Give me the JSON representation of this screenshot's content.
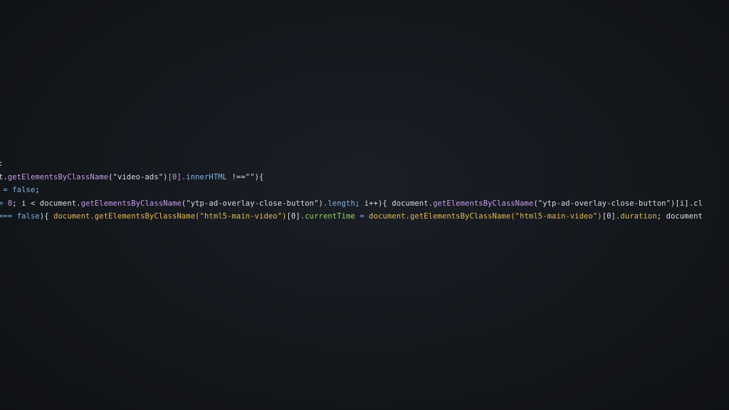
{
  "code_lines": [
    [
      {
        "t": ":",
        "c": "plain"
      }
    ],
    [
      {
        "t": "t.",
        "c": "plain"
      },
      {
        "t": "getElementsByClassName",
        "c": "fn"
      },
      {
        "t": "(\"video-ads\")",
        "c": "str"
      },
      {
        "t": "[0]",
        "c": "num"
      },
      {
        "t": ".innerHTML",
        "c": "prop"
      },
      {
        "t": " !==\"\"){",
        "c": "plain"
      }
    ],
    [
      {
        "t": " = ",
        "c": "op"
      },
      {
        "t": "false",
        "c": "kw"
      },
      {
        "t": ";",
        "c": "plain"
      }
    ],
    [
      {
        "t": "= ",
        "c": "op"
      },
      {
        "t": "0",
        "c": "num"
      },
      {
        "t": "; i < document.",
        "c": "plain"
      },
      {
        "t": "getElementsByClassName",
        "c": "fn"
      },
      {
        "t": "(\"ytp-ad-overlay-close-button\")",
        "c": "str"
      },
      {
        "t": ".length",
        "c": "prop"
      },
      {
        "t": "; i++){ document.",
        "c": "plain"
      },
      {
        "t": "getElementsByClassName",
        "c": "fn"
      },
      {
        "t": "(\"ytp-ad-overlay-close-button\")",
        "c": "str"
      },
      {
        "t": "[i].cl",
        "c": "plain"
      }
    ],
    [
      {
        "t": "=== ",
        "c": "op"
      },
      {
        "t": "false",
        "c": "kw"
      },
      {
        "t": "){ ",
        "c": "plain"
      },
      {
        "t": "document.getElementsByClassName",
        "c": "o-fn"
      },
      {
        "t": "(\"html5-main-video\")",
        "c": "o-str"
      },
      {
        "t": "[0]",
        "c": "plain"
      },
      {
        "t": ".currentTime",
        "c": "g-prop"
      },
      {
        "t": " = ",
        "c": "op"
      },
      {
        "t": "document.getElementsByClassName",
        "c": "o-fn"
      },
      {
        "t": "(\"html5-main-video\")",
        "c": "o-str"
      },
      {
        "t": "[0]",
        "c": "plain"
      },
      {
        "t": ".duration",
        "c": "o-prop"
      },
      {
        "t": "; document",
        "c": "plain"
      }
    ]
  ]
}
